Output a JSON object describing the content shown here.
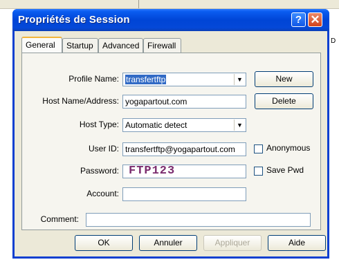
{
  "window": {
    "title": "Propriétés de Session"
  },
  "tabs": [
    {
      "label": "General"
    },
    {
      "label": "Startup"
    },
    {
      "label": "Advanced"
    },
    {
      "label": "Firewall"
    }
  ],
  "form": {
    "profile_name_label": "Profile Name:",
    "profile_name_value": "transfertftp",
    "host_label": "Host Name/Address:",
    "host_value": "yogapartout.com",
    "host_type_label": "Host Type:",
    "host_type_value": "Automatic detect",
    "user_id_label": "User ID:",
    "user_id_value": "transfertftp@yogapartout.com",
    "password_label": "Password:",
    "password_value": "FTP123",
    "account_label": "Account:",
    "account_value": "",
    "comment_label": "Comment:",
    "comment_value": ""
  },
  "side_buttons": {
    "new": "New",
    "delete": "Delete"
  },
  "checkboxes": {
    "anonymous": "Anonymous",
    "save_pwd": "Save Pwd"
  },
  "footer": {
    "ok": "OK",
    "cancel": "Annuler",
    "apply": "Appliquer",
    "help": "Aide"
  },
  "background": {
    "edge_char": "D"
  },
  "title_buttons": {
    "help": "?",
    "close": "✕"
  }
}
